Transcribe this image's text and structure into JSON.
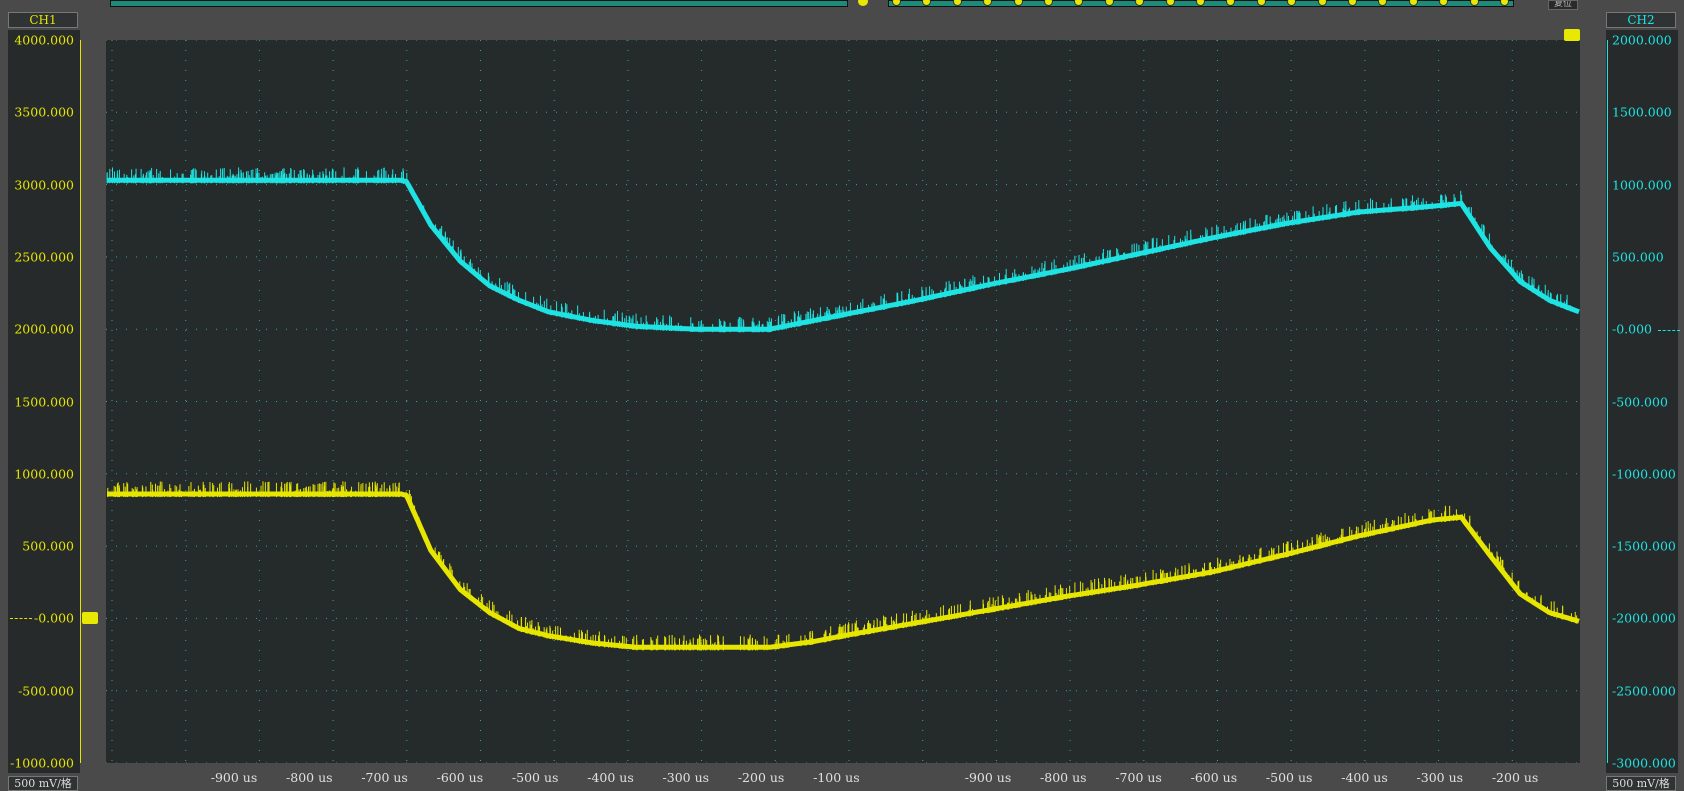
{
  "channels": {
    "ch1": {
      "label": "CH1",
      "scale": "500 mV/格",
      "color": "#e6e600"
    },
    "ch2": {
      "label": "CH2",
      "scale": "500 mV/格",
      "color": "#1fe3e3"
    }
  },
  "toolbar": {
    "reset_label": "复位"
  },
  "left_axis_ticks": [
    "4000.000",
    "3500.000",
    "3000.000",
    "2500.000",
    "2000.000",
    "1500.000",
    "1000.000",
    "500.000",
    "-0.000",
    "-500.000",
    "-1000.000"
  ],
  "right_axis_ticks": [
    "2000.000",
    "1500.000",
    "1000.000",
    "500.000",
    "-0.000",
    "-500.000",
    "-1000.000",
    "-1500.000",
    "-2000.000",
    "-2500.000",
    "-3000.000"
  ],
  "x_axis_ticks": [
    "-900 us",
    "-800 us",
    "-700 us",
    "-600 us",
    "-500 us",
    "-400 us",
    "-300 us",
    "-200 us",
    "-100 us",
    "-900 us",
    "-800 us",
    "-700 us",
    "-600 us",
    "-500 us",
    "-400 us",
    "-300 us",
    "-200 us"
  ],
  "chart_data": {
    "type": "line",
    "grid": true,
    "x_ticks": [
      "-900 us",
      "-800 us",
      "-700 us",
      "-600 us",
      "-500 us",
      "-400 us",
      "-300 us",
      "-200 us",
      "-100 us",
      "-900 us",
      "-800 us",
      "-700 us",
      "-600 us",
      "-500 us",
      "-400 us",
      "-300 us",
      "-200 us"
    ],
    "y_left_range": [
      -1000,
      4000
    ],
    "y_right_range": [
      -3000,
      2000
    ],
    "series": [
      {
        "name": "CH2",
        "axis": "right",
        "color": "#1fe3e3",
        "t": [
          0,
          0.2,
          0.2035,
          0.22,
          0.24,
          0.26,
          0.28,
          0.3,
          0.33,
          0.36,
          0.4,
          0.45,
          0.5,
          0.55,
          0.6,
          0.65,
          0.7,
          0.75,
          0.8,
          0.85,
          0.9,
          0.92,
          0.94,
          0.96,
          0.98,
          1.0
        ],
        "values": [
          1030,
          1030,
          1020,
          720,
          470,
          300,
          200,
          120,
          60,
          20,
          0,
          0,
          100,
          200,
          310,
          410,
          520,
          630,
          730,
          810,
          850,
          870,
          560,
          330,
          200,
          120
        ]
      },
      {
        "name": "CH1",
        "axis": "left",
        "color": "#e6e600",
        "t": [
          0,
          0.2,
          0.2035,
          0.22,
          0.24,
          0.26,
          0.28,
          0.3,
          0.33,
          0.36,
          0.4,
          0.45,
          0.48,
          0.5,
          0.55,
          0.6,
          0.65,
          0.7,
          0.75,
          0.8,
          0.85,
          0.9,
          0.92,
          0.94,
          0.96,
          0.98,
          1.0
        ],
        "values": [
          860,
          860,
          850,
          470,
          200,
          40,
          -70,
          -120,
          -170,
          -200,
          -200,
          -200,
          -160,
          -120,
          -30,
          60,
          150,
          230,
          320,
          440,
          570,
          680,
          700,
          430,
          170,
          40,
          -20
        ]
      }
    ]
  }
}
